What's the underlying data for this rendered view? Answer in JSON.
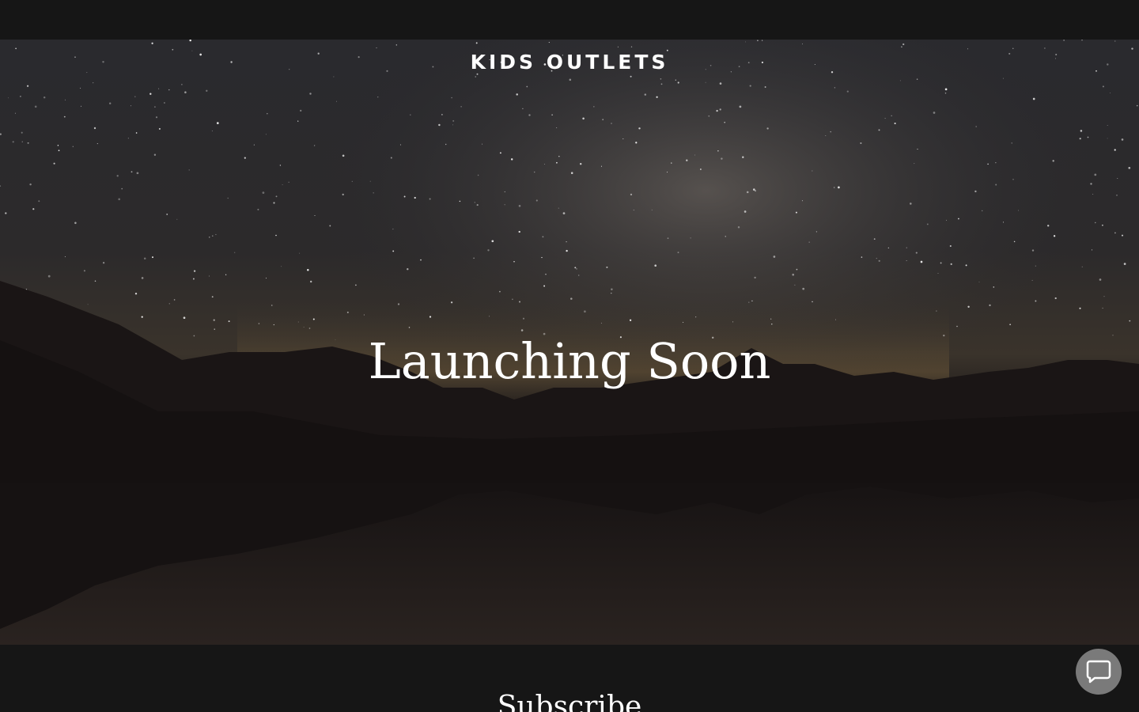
{
  "header": {
    "brand": "KIDS OUTLETS"
  },
  "hero": {
    "headline": "Launching Soon"
  },
  "subscribe": {
    "title": "Subscribe"
  },
  "chat": {
    "icon": "chat-bubble-icon"
  },
  "colors": {
    "page_background": "#161616",
    "text": "#ffffff",
    "chat_button": "#7a7a7a"
  }
}
